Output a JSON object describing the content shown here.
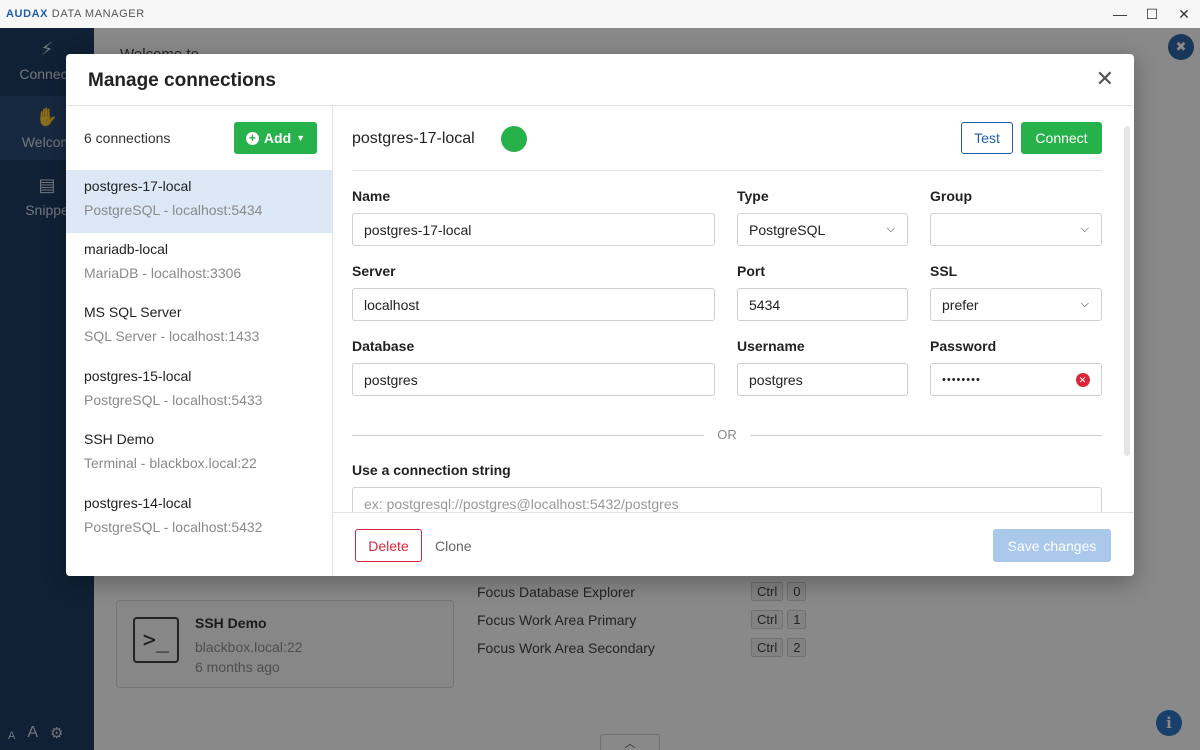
{
  "window": {
    "brand": "AUDAX",
    "title": "DATA MANAGER",
    "controls": {
      "minimize": "—",
      "maximize": "☐",
      "close": "✕"
    }
  },
  "sidebar": {
    "items": [
      {
        "label": "Connecti",
        "icon": "lightning-icon"
      },
      {
        "label": "Welcom",
        "icon": "wave-hand-icon"
      },
      {
        "label": "Snippe",
        "icon": "snippet-file-icon"
      }
    ],
    "bottom": {
      "font_small": "A",
      "font_large": "A"
    }
  },
  "background": {
    "welcome": "Welcome to",
    "card": {
      "title": "SSH Demo",
      "host": "blackbox.local:22",
      "time": "6 months ago",
      "icon_glyph": ">_"
    },
    "shortcuts": [
      {
        "label": "Focus Database Explorer",
        "mod": "Ctrl",
        "key": "0"
      },
      {
        "label": "Focus Work Area Primary",
        "mod": "Ctrl",
        "key": "1"
      },
      {
        "label": "Focus Work Area Secondary",
        "mod": "Ctrl",
        "key": "2"
      }
    ]
  },
  "modal": {
    "title": "Manage connections",
    "close": "✕",
    "list": {
      "count": "6 connections",
      "add_label": "Add",
      "items": [
        {
          "name": "postgres-17-local",
          "desc": "PostgreSQL - localhost:5434"
        },
        {
          "name": "mariadb-local",
          "desc": "MariaDB - localhost:3306"
        },
        {
          "name": "MS SQL Server",
          "desc": "SQL Server - localhost:1433"
        },
        {
          "name": "postgres-15-local",
          "desc": "PostgreSQL - localhost:5433"
        },
        {
          "name": "SSH Demo",
          "desc": "Terminal - blackbox.local:22"
        },
        {
          "name": "postgres-14-local",
          "desc": "PostgreSQL - localhost:5432"
        }
      ]
    },
    "form": {
      "title": "postgres-17-local",
      "status_color": "#26b14a",
      "test_label": "Test",
      "connect_label": "Connect",
      "labels": {
        "name": "Name",
        "type": "Type",
        "group": "Group",
        "server": "Server",
        "port": "Port",
        "ssl": "SSL",
        "database": "Database",
        "username": "Username",
        "password": "Password"
      },
      "values": {
        "name": "postgres-17-local",
        "type": "PostgreSQL",
        "group": "",
        "server": "localhost",
        "port": "5434",
        "ssl": "prefer",
        "database": "postgres",
        "username": "postgres",
        "password": "••••••••"
      },
      "or_text": "OR",
      "conn_string_label": "Use a connection string",
      "conn_string_placeholder": "ex: postgresql://postgres@localhost:5432/postgres"
    },
    "footer": {
      "delete_label": "Delete",
      "clone_label": "Clone",
      "save_label": "Save changes"
    }
  }
}
